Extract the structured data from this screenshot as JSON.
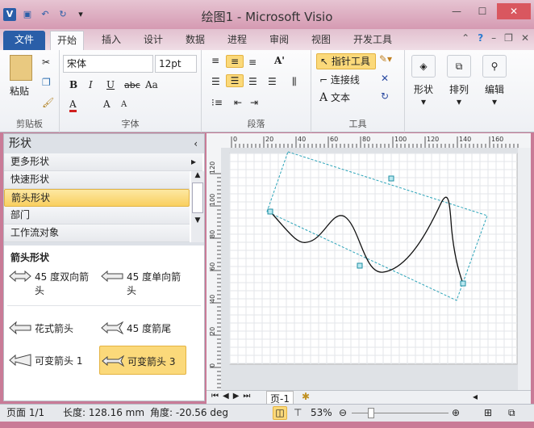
{
  "window": {
    "title": "绘图1 - Microsoft Visio",
    "app_icon": "V"
  },
  "menu_tabs": [
    "文件",
    "开始",
    "插入",
    "设计",
    "数据",
    "进程",
    "审阅",
    "视图",
    "开发工具"
  ],
  "active_tab": "开始",
  "ribbon": {
    "clipboard": {
      "label": "剪贴板",
      "paste": "粘贴"
    },
    "font": {
      "label": "字体",
      "font_name": "宋体",
      "font_size": "12pt",
      "bold": "B",
      "italic": "I",
      "underline": "U",
      "strike": "abc",
      "case": "Aa",
      "color": "A",
      "grow": "A",
      "shrink": "A"
    },
    "paragraph": {
      "label": "段落"
    },
    "tools": {
      "label": "工具",
      "pointer": "指针工具",
      "connector": "连接线",
      "text": "文本"
    },
    "shape": {
      "label": "形状"
    },
    "arrange": {
      "label": "排列"
    },
    "edit": {
      "label": "编辑"
    }
  },
  "shapes_pane": {
    "title": "形状",
    "more": "更多形状",
    "stencils": [
      "快速形状",
      "箭头形状",
      "部门",
      "工作流对象"
    ],
    "selected_stencil": "箭头形状",
    "stencil_title": "箭头形状",
    "masters": [
      "45 度双向箭头",
      "45 度单向箭头",
      "花式箭头",
      "45 度箭尾",
      "可变箭头 1",
      "可变箭头 3"
    ],
    "selected_master": "可变箭头 3"
  },
  "ruler": {
    "h": [
      "0",
      "20",
      "40",
      "60",
      "80",
      "100",
      "120",
      "140",
      "160"
    ],
    "v": [
      "120",
      "100",
      "80",
      "60",
      "40",
      "20",
      "0"
    ]
  },
  "page_tabs": {
    "current": "页-1"
  },
  "status": {
    "page": "页面 1/1",
    "length": "长度: 128.16 mm",
    "angle": "角度: -20.56 deg",
    "zoom": "53%"
  },
  "colors": {
    "accent": "#2a5ea8",
    "highlight": "#fbd97a",
    "selection": "#2aa3b8"
  }
}
